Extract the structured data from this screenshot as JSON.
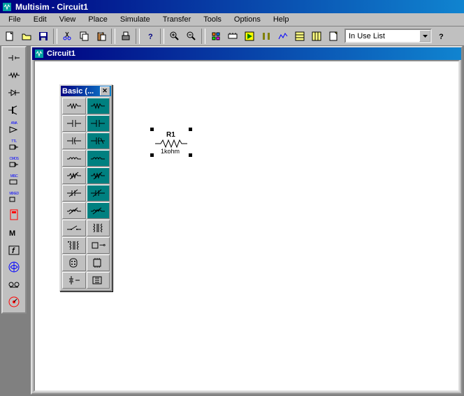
{
  "app": {
    "title": "Multisim - Circuit1"
  },
  "menu": [
    "File",
    "Edit",
    "View",
    "Place",
    "Simulate",
    "Transfer",
    "Tools",
    "Options",
    "Help"
  ],
  "toolbar": {
    "combo": "In Use List"
  },
  "childwin": {
    "title": "Circuit1"
  },
  "palette": {
    "title": "Basic (..."
  },
  "component": {
    "name": "R1",
    "value": "1kohm"
  }
}
